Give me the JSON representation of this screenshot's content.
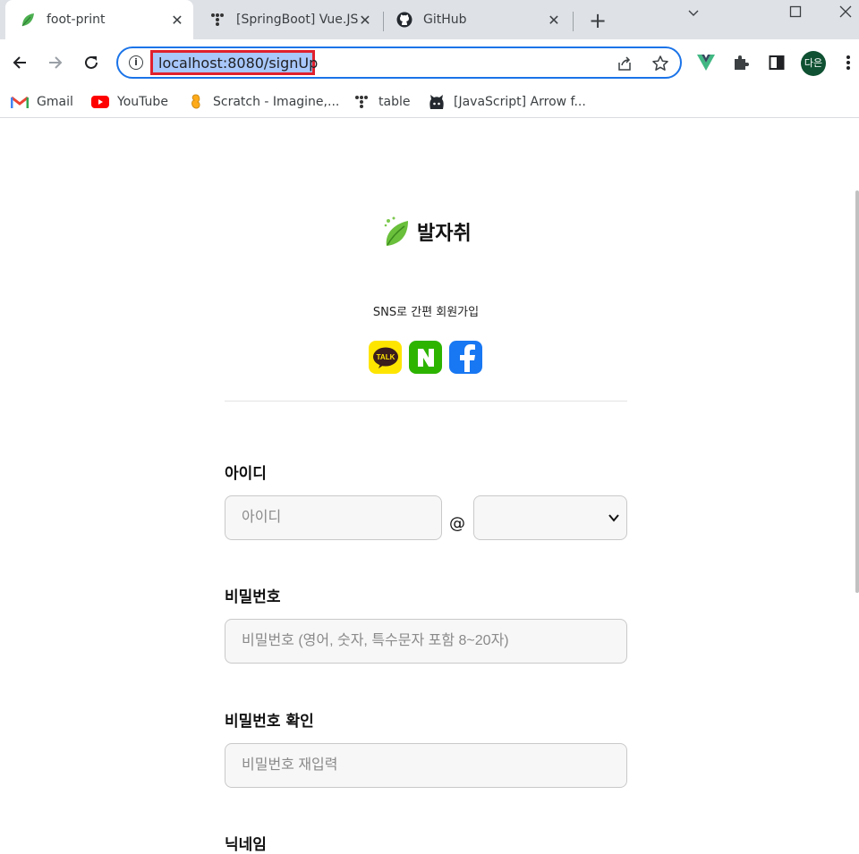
{
  "browser": {
    "tabs": [
      {
        "title": "foot-print",
        "icon": "leaf-icon",
        "active": true
      },
      {
        "title": "[SpringBoot] Vue.JS",
        "icon": "dots-icon",
        "active": false
      },
      {
        "title": "GitHub",
        "icon": "github-icon",
        "active": false
      }
    ],
    "close_glyph": "✕",
    "new_tab_glyph": "+",
    "window_controls": {
      "minimize": "﹀",
      "maximize": "☐",
      "close": "✕"
    },
    "address_bar": {
      "url": "localhost:8080/signUp",
      "info_glyph": "i"
    },
    "profile_initials": "다은",
    "bookmarks": [
      {
        "label": "Gmail",
        "icon": "gmail-icon"
      },
      {
        "label": "YouTube",
        "icon": "youtube-icon"
      },
      {
        "label": "Scratch - Imagine,...",
        "icon": "scratch-icon"
      },
      {
        "label": "table",
        "icon": "dots-icon"
      },
      {
        "label": "[JavaScript] Arrow f...",
        "icon": "github-icon"
      }
    ]
  },
  "page": {
    "logo_text": "발자취",
    "sns_title": "SNS로 간편 회원가입",
    "sns_buttons": [
      {
        "name": "kakao",
        "label": "TALK",
        "color": "#fee500"
      },
      {
        "name": "naver",
        "label": "N",
        "color": "#2db400"
      },
      {
        "name": "facebook",
        "label": "f",
        "color": "#1877f2"
      }
    ],
    "form": {
      "id_label": "아이디",
      "id_placeholder": "아이디",
      "at_sign": "@",
      "domain_selected": "",
      "password_label": "비밀번호",
      "password_placeholder": "비밀번호 (영어, 숫자, 특수문자 포함 8~20자)",
      "password_confirm_label": "비밀번호 확인",
      "password_confirm_placeholder": "비밀번호 재입력",
      "nickname_label": "닉네임"
    }
  }
}
